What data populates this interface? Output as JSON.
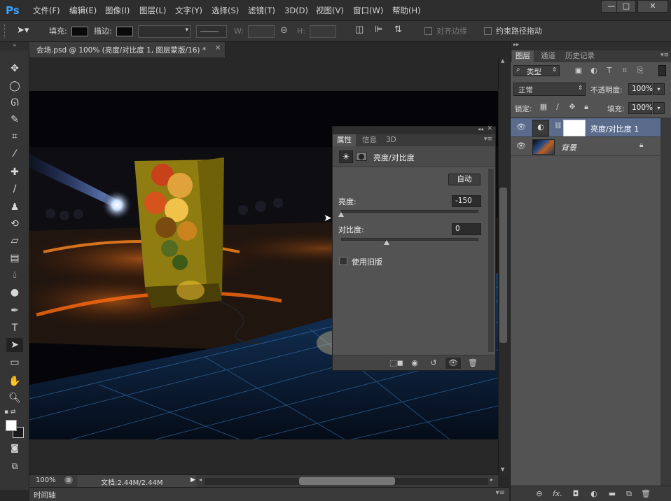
{
  "app": {
    "logo": "Ps"
  },
  "menu": [
    "文件(F)",
    "编辑(E)",
    "图像(I)",
    "图层(L)",
    "文字(Y)",
    "选择(S)",
    "滤镜(T)",
    "3D(D)",
    "视图(V)",
    "窗口(W)",
    "帮助(H)"
  ],
  "window_controls": {
    "minimize": "—",
    "maximize": "□",
    "close": "✕"
  },
  "options": {
    "fill_label": "填充:",
    "stroke_label": "描边:",
    "w_label": "W:",
    "h_label": "H:",
    "align_edges": "对齐边缘",
    "constrain_path": "约束路径拖动"
  },
  "document": {
    "tab_title": "会场.psd @ 100% (亮度/对比度 1, 图层蒙版/16) *",
    "zoom": "100%",
    "doc_size": "文档:2.44M/2.44M",
    "timeline_label": "时间轴"
  },
  "properties_panel": {
    "tabs": [
      "属性",
      "信息",
      "3D"
    ],
    "title": "亮度/对比度",
    "auto_button": "自动",
    "brightness_label": "亮度:",
    "brightness_value": "-150",
    "brightness_level": -150,
    "contrast_label": "对比度:",
    "contrast_value": "0",
    "contrast_level": 0,
    "legacy_label": "使用旧版"
  },
  "layers_panel": {
    "tabs": [
      "图层",
      "通道",
      "历史记录"
    ],
    "filter_kind": "类型",
    "blend_mode": "正常",
    "opacity_label": "不透明度:",
    "opacity_value": "100%",
    "lock_label": "锁定:",
    "fill_label": "填充:",
    "fill_value": "100%",
    "layers": [
      {
        "name": "亮度/对比度 1",
        "selected": true
      },
      {
        "name": "背景",
        "selected": false,
        "locked": true
      }
    ]
  },
  "colors": {
    "accent": "#3aa3ff",
    "panel": "#535353",
    "selection": "#5a6b8c"
  }
}
